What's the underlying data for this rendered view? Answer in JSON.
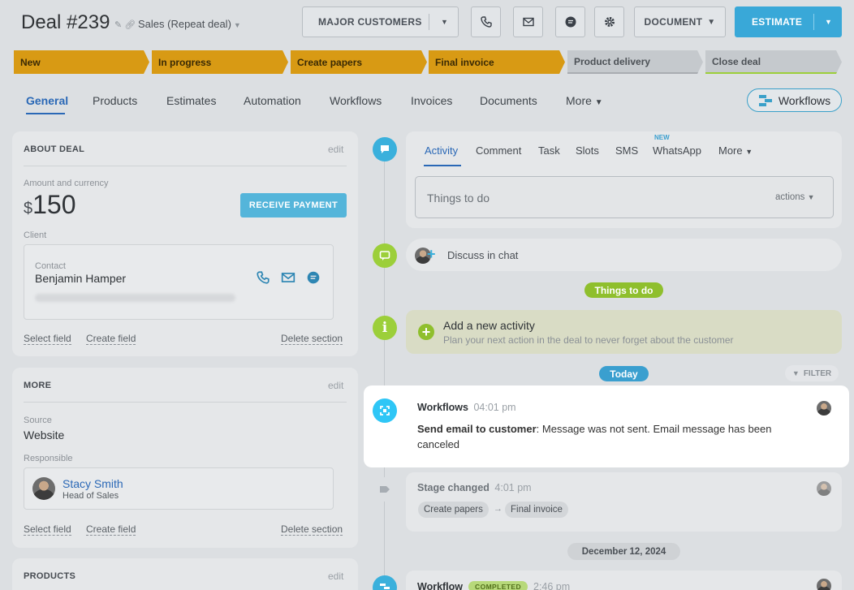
{
  "header": {
    "title": "Deal #239",
    "category": "Sales (Repeat deal)",
    "major_customers": "MAJOR CUSTOMERS",
    "document": "DOCUMENT",
    "estimate": "ESTIMATE"
  },
  "pipeline": [
    "New",
    "In progress",
    "Create papers",
    "Final invoice",
    "Product delivery",
    "Close deal"
  ],
  "tabs": {
    "general": "General",
    "products": "Products",
    "estimates": "Estimates",
    "automation": "Automation",
    "workflows": "Workflows",
    "invoices": "Invoices",
    "documents": "Documents",
    "more": "More",
    "workflows_button": "Workflows"
  },
  "about": {
    "heading": "ABOUT DEAL",
    "edit": "edit",
    "amount_label": "Amount and currency",
    "currency": "$",
    "amount": "150",
    "receive_payment": "RECEIVE PAYMENT",
    "client_label": "Client",
    "contact_label": "Contact",
    "contact_name": "Benjamin Hamper",
    "select_field": "Select field",
    "create_field": "Create field",
    "delete_section": "Delete section"
  },
  "more_card": {
    "heading": "MORE",
    "edit": "edit",
    "source_label": "Source",
    "source_value": "Website",
    "responsible_label": "Responsible",
    "responsible_name": "Stacy Smith",
    "responsible_role": "Head of Sales",
    "select_field": "Select field",
    "create_field": "Create field",
    "delete_section": "Delete section"
  },
  "products_card": {
    "heading": "PRODUCTS",
    "edit": "edit"
  },
  "activity": {
    "tabs": {
      "activity": "Activity",
      "comment": "Comment",
      "task": "Task",
      "slots": "Slots",
      "sms": "SMS",
      "whatsapp": "WhatsApp",
      "whatsapp_badge": "NEW",
      "more": "More"
    },
    "placeholder": "Things to do",
    "actions": "actions"
  },
  "timeline": {
    "discuss": "Discuss in chat",
    "things_to_do": "Things to do",
    "add_title": "Add a new activity",
    "add_sub": "Plan your next action in the deal to never forget about the customer",
    "today": "Today",
    "filter": "FILTER",
    "wf_author": "Workflows",
    "wf_time": "04:01 pm",
    "wf_bold": "Send email to customer",
    "wf_text": ": Message was not sent. Email message has been canceled",
    "stage_title": "Stage changed",
    "stage_time": "4:01 pm",
    "stage_from": "Create papers",
    "stage_to": "Final invoice",
    "date_pill": "December 12, 2024",
    "wf2_author": "Workflow",
    "wf2_badge": "COMPLETED",
    "wf2_time": "2:46 pm"
  },
  "colors": {
    "accent_blue": "#2a68b6",
    "estimate": "#39a8d8",
    "stage_done": "#d89a14",
    "green": "#9ccf3a",
    "cyan": "#2fc6f6"
  }
}
